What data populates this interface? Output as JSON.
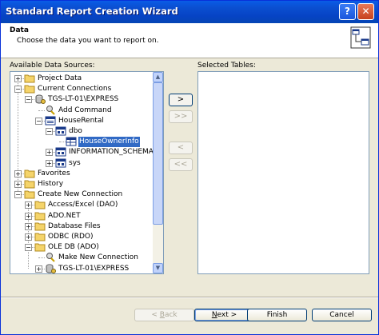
{
  "window": {
    "title": "Standard Report Creation Wizard",
    "help_glyph": "?",
    "close_glyph": "✕"
  },
  "header": {
    "title": "Data",
    "subtitle": "Choose the data you want to report on."
  },
  "labels": {
    "available": "Available Data Sources:",
    "selected": "Selected Tables:"
  },
  "tree": [
    {
      "label": "Project Data",
      "icon": "folder-icon",
      "expander": "+",
      "level": 0
    },
    {
      "label": "Current Connections",
      "icon": "folder-icon",
      "expander": "−",
      "level": 0
    },
    {
      "label": "TGS-LT-01\\EXPRESS",
      "icon": "database-server-icon",
      "expander": "−",
      "level": 1
    },
    {
      "label": "Add Command",
      "icon": "command-icon",
      "expander": "",
      "level": 2
    },
    {
      "label": "HouseRental",
      "icon": "database-icon",
      "expander": "−",
      "level": 2
    },
    {
      "label": "dbo",
      "icon": "schema-icon",
      "expander": "−",
      "level": 3
    },
    {
      "label": "HouseOwnerInfo",
      "icon": "table-icon",
      "expander": "",
      "level": 4,
      "selected": true
    },
    {
      "label": "INFORMATION_SCHEMA",
      "icon": "schema-icon",
      "expander": "+",
      "level": 3
    },
    {
      "label": "sys",
      "icon": "schema-icon",
      "expander": "+",
      "level": 3
    },
    {
      "label": "Favorites",
      "icon": "folder-icon",
      "expander": "+",
      "level": 0
    },
    {
      "label": "History",
      "icon": "folder-icon",
      "expander": "+",
      "level": 0
    },
    {
      "label": "Create New Connection",
      "icon": "folder-icon",
      "expander": "−",
      "level": 0
    },
    {
      "label": "Access/Excel (DAO)",
      "icon": "folder-icon",
      "expander": "+",
      "level": 1
    },
    {
      "label": "ADO.NET",
      "icon": "folder-icon",
      "expander": "+",
      "level": 1
    },
    {
      "label": "Database Files",
      "icon": "folder-icon",
      "expander": "+",
      "level": 1
    },
    {
      "label": "ODBC (RDO)",
      "icon": "folder-icon",
      "expander": "+",
      "level": 1
    },
    {
      "label": "OLE DB (ADO)",
      "icon": "folder-icon",
      "expander": "−",
      "level": 1
    },
    {
      "label": "Make New Connection",
      "icon": "command-icon",
      "expander": "",
      "level": 2
    },
    {
      "label": "TGS-LT-01\\EXPRESS",
      "icon": "database-server-icon",
      "expander": "+",
      "level": 2
    }
  ],
  "move_buttons": {
    "add": ">",
    "add_all": ">>",
    "remove": "<",
    "remove_all": "<<"
  },
  "buttons": {
    "back_prefix": "< ",
    "back_key": "B",
    "back_rest": "ack",
    "next_key": "N",
    "next_rest": "ext >",
    "finish": "Finish",
    "cancel": "Cancel"
  },
  "colors": {
    "title_bar": "#0a5ce6",
    "selection": "#316ac5",
    "dialog_bg": "#ece9d8"
  }
}
